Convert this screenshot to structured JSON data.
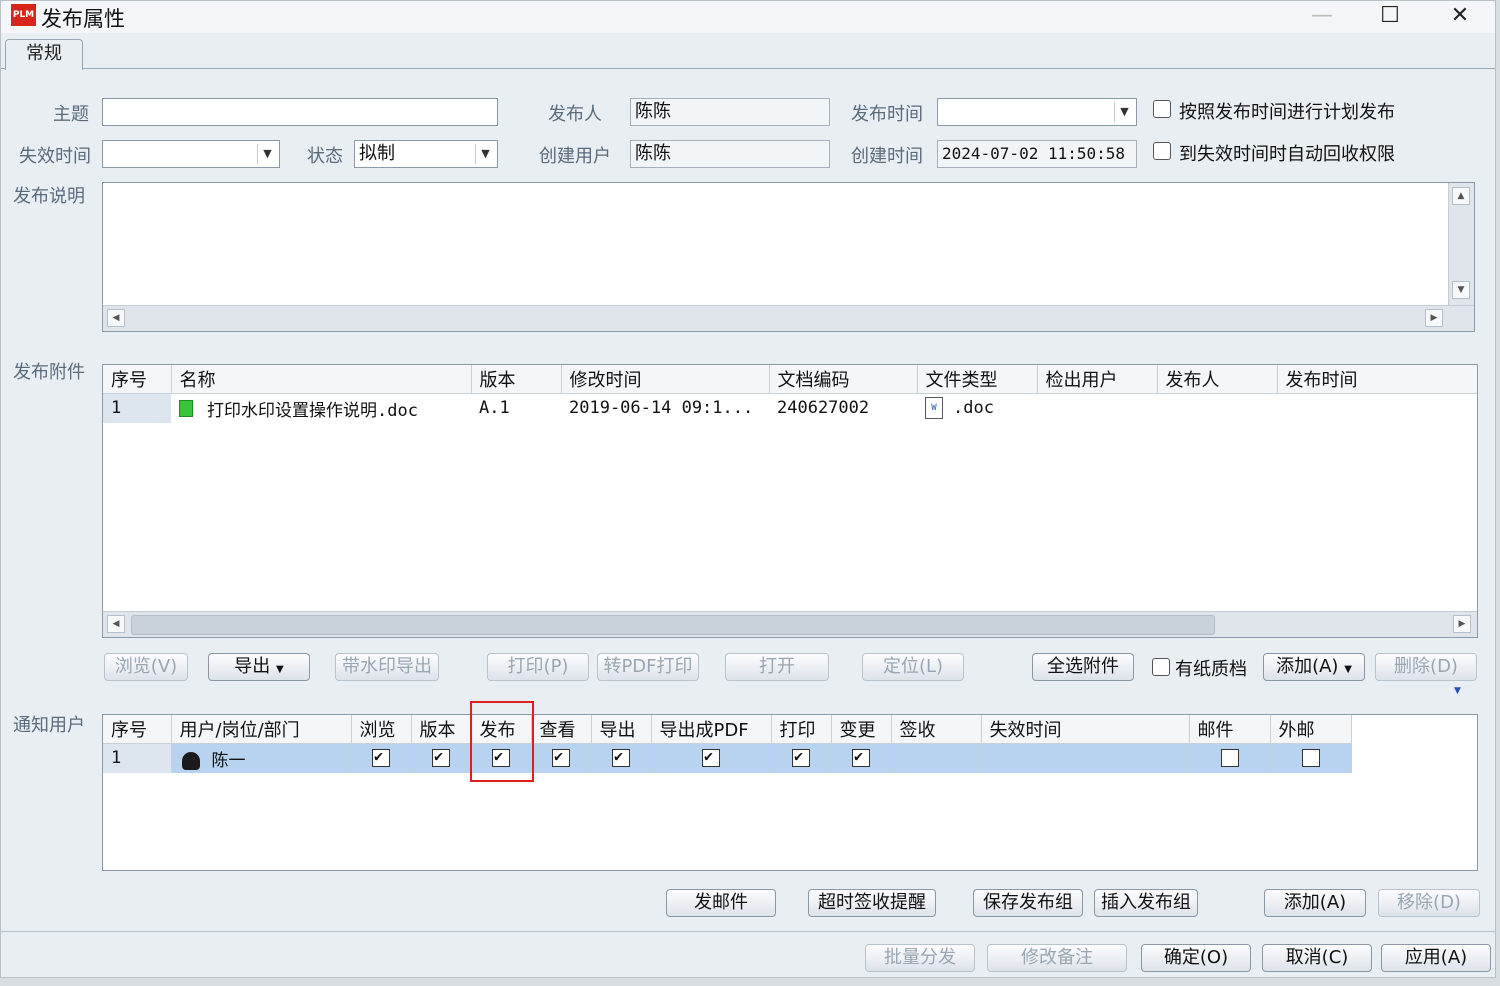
{
  "window": {
    "title": "发布属性",
    "logo_text": "PLM",
    "minimize": "—",
    "maximize": "☐",
    "close": "✕"
  },
  "tabs": [
    {
      "label": "常规"
    }
  ],
  "form": {
    "subject_label": "主题",
    "subject_value": "",
    "publisher_label": "发布人",
    "publisher_value": "陈陈",
    "publish_time_label": "发布时间",
    "publish_time_value": "",
    "schedule_label": "按照发布时间进行计划发布",
    "expire_time_label": "失效时间",
    "expire_time_value": "",
    "status_label": "状态",
    "status_value": "拟制",
    "creator_label": "创建用户",
    "creator_value": "陈陈",
    "create_time_label": "创建时间",
    "create_time_value": "2024-07-02 11:50:58",
    "auto_revoke_label": "到失效时间时自动回收权限",
    "desc_label": "发布说明",
    "desc_value": ""
  },
  "attachments": {
    "label": "发布附件",
    "columns": [
      "序号",
      "名称",
      "版本",
      "修改时间",
      "文档编码",
      "文件类型",
      "检出用户",
      "发布人",
      "发布时间"
    ],
    "rows": [
      {
        "seq": "1",
        "name": "打印水印设置操作说明.doc",
        "version": "A.1",
        "modified": "2019-06-14 09:1...",
        "code": "240627002",
        "filetype": ".doc",
        "checkout": "",
        "publisher": "",
        "pubtime": ""
      }
    ]
  },
  "attach_buttons": {
    "browse": "浏览(V)",
    "export": "导出",
    "watermark_export": "带水印导出",
    "print": "打印(P)",
    "pdf_print": "转PDF打印",
    "open": "打开",
    "locate": "定位(L)",
    "select_all": "全选附件",
    "paper_label": "有纸质档",
    "add": "添加(A)",
    "delete": "删除(D)"
  },
  "notify": {
    "label": "通知用户",
    "columns": [
      "序号",
      "用户/岗位/部门",
      "浏览",
      "版本",
      "发布",
      "查看",
      "导出",
      "导出成PDF",
      "打印",
      "变更",
      "签收",
      "失效时间",
      "邮件",
      "外邮"
    ],
    "rows": [
      {
        "seq": "1",
        "user": "陈一",
        "browse": true,
        "version": true,
        "publish": true,
        "view": true,
        "export": true,
        "export_pdf": true,
        "print": true,
        "change": true,
        "sign": "",
        "expire": "",
        "mail": false,
        "ext_mail": false
      }
    ]
  },
  "notify_buttons": {
    "send_mail": "发邮件",
    "timeout_remind": "超时签收提醒",
    "save_group": "保存发布组",
    "insert_group": "插入发布组",
    "add": "添加(A)",
    "remove": "移除(D)"
  },
  "footer_buttons": {
    "batch": "批量分发",
    "edit_note": "修改备注",
    "ok": "确定(O)",
    "cancel": "取消(C)",
    "apply": "应用(A)"
  },
  "colors": {
    "selected_row": "#b8d3ef",
    "highlight": "#e02020",
    "window_bg": "#e9eef3"
  }
}
